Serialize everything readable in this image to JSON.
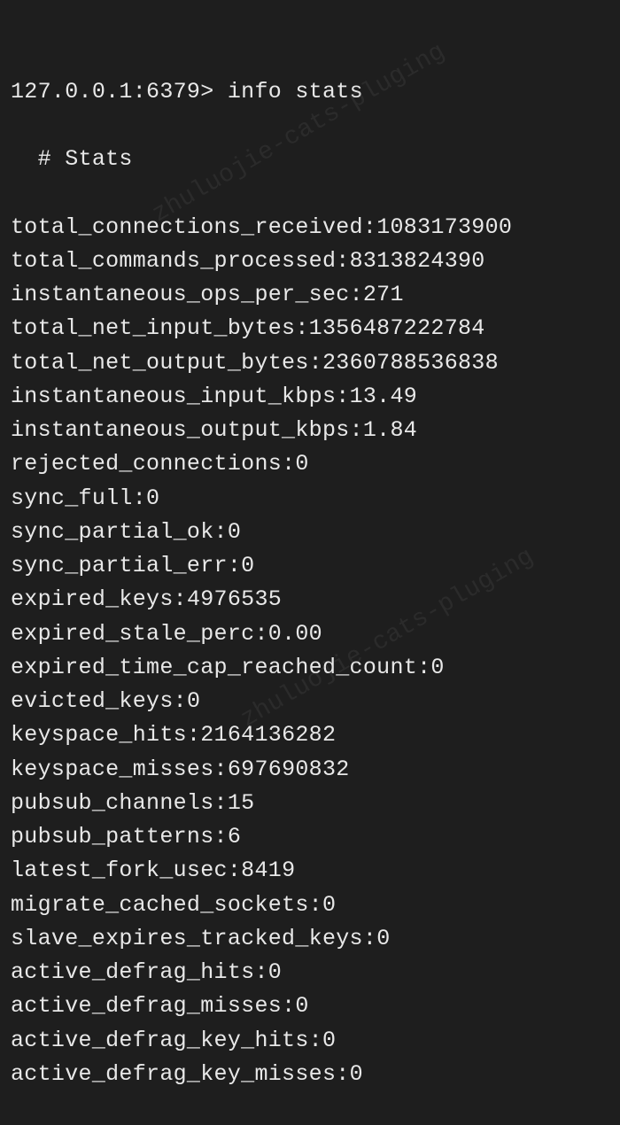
{
  "prompt": {
    "host": "127.0.0.1:6379>",
    "command": "info stats"
  },
  "section_header": "# Stats",
  "stats": [
    {
      "key": "total_connections_received",
      "value": "1083173900"
    },
    {
      "key": "total_commands_processed",
      "value": "8313824390"
    },
    {
      "key": "instantaneous_ops_per_sec",
      "value": "271"
    },
    {
      "key": "total_net_input_bytes",
      "value": "1356487222784"
    },
    {
      "key": "total_net_output_bytes",
      "value": "2360788536838"
    },
    {
      "key": "instantaneous_input_kbps",
      "value": "13.49"
    },
    {
      "key": "instantaneous_output_kbps",
      "value": "1.84"
    },
    {
      "key": "rejected_connections",
      "value": "0"
    },
    {
      "key": "sync_full",
      "value": "0"
    },
    {
      "key": "sync_partial_ok",
      "value": "0"
    },
    {
      "key": "sync_partial_err",
      "value": "0"
    },
    {
      "key": "expired_keys",
      "value": "4976535"
    },
    {
      "key": "expired_stale_perc",
      "value": "0.00"
    },
    {
      "key": "expired_time_cap_reached_count",
      "value": "0"
    },
    {
      "key": "evicted_keys",
      "value": "0"
    },
    {
      "key": "keyspace_hits",
      "value": "2164136282"
    },
    {
      "key": "keyspace_misses",
      "value": "697690832"
    },
    {
      "key": "pubsub_channels",
      "value": "15"
    },
    {
      "key": "pubsub_patterns",
      "value": "6"
    },
    {
      "key": "latest_fork_usec",
      "value": "8419"
    },
    {
      "key": "migrate_cached_sockets",
      "value": "0"
    },
    {
      "key": "slave_expires_tracked_keys",
      "value": "0"
    },
    {
      "key": "active_defrag_hits",
      "value": "0"
    },
    {
      "key": "active_defrag_misses",
      "value": "0"
    },
    {
      "key": "active_defrag_key_hits",
      "value": "0"
    },
    {
      "key": "active_defrag_key_misses",
      "value": "0"
    }
  ],
  "watermark": "zhuluojie-cats-pluging"
}
